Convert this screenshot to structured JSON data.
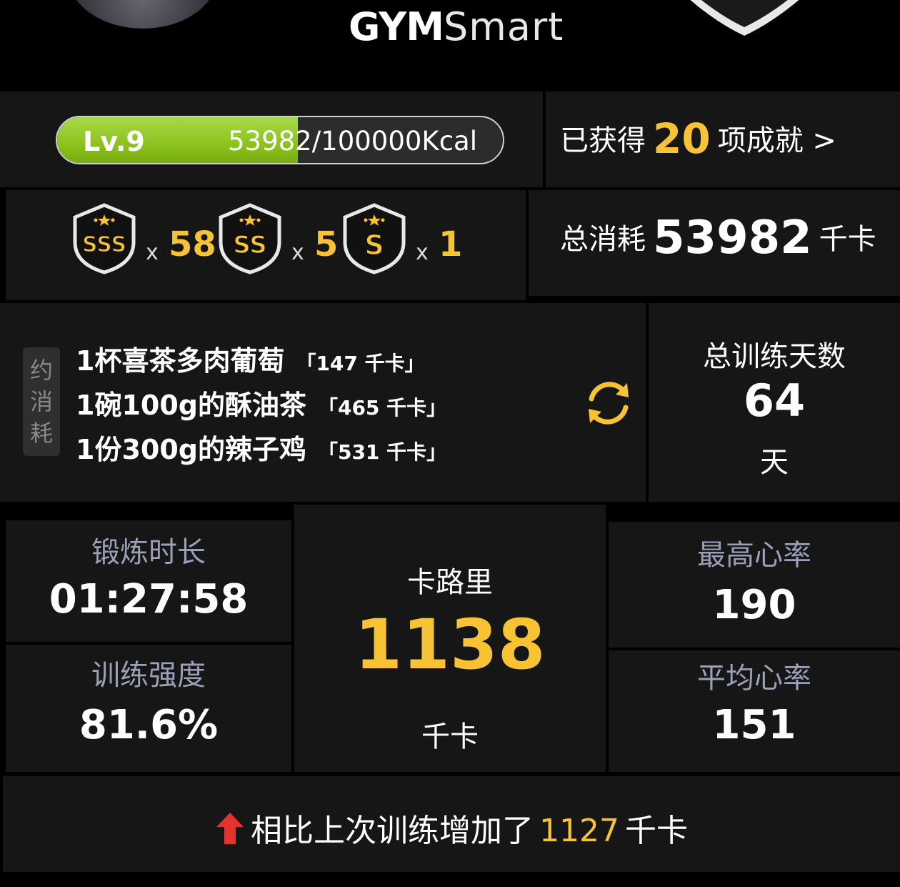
{
  "header": {
    "logo_bold": "GYM",
    "logo_light": "Smart"
  },
  "level": {
    "label": "Lv.9",
    "current_kcal": 53982,
    "target_kcal": 100000,
    "progress_text": "53982/100000Kcal",
    "progress_fraction": 0.54
  },
  "achievements": {
    "prefix": "已获得",
    "count": "20",
    "suffix": "项成就 >"
  },
  "grades": [
    {
      "grade": "SSS",
      "x": "x",
      "count": "58"
    },
    {
      "grade": "SS",
      "x": "x",
      "count": "5"
    },
    {
      "grade": "S",
      "x": "x",
      "count": "1"
    }
  ],
  "total_consumption": {
    "label": "总消耗",
    "value": "53982",
    "unit": "千卡"
  },
  "equivalent": {
    "tag": "约消耗",
    "items": [
      {
        "food": "1杯喜茶多肉葡萄",
        "kcal": "「147 千卡」"
      },
      {
        "food": "1碗100g的酥油茶",
        "kcal": "「465 千卡」"
      },
      {
        "food": "1份300g的辣子鸡",
        "kcal": "「531 千卡」"
      }
    ]
  },
  "training_days": {
    "label": "总训练天数",
    "value": "64",
    "unit": "天"
  },
  "stats": {
    "duration_label": "锻炼时长",
    "duration_value": "01:27:58",
    "intensity_label": "训练强度",
    "intensity_value": "81.6%",
    "calories_label": "卡路里",
    "calories_value": "1138",
    "calories_unit": "千卡",
    "max_hr_label": "最高心率",
    "max_hr_value": "190",
    "avg_hr_label": "平均心率",
    "avg_hr_value": "151"
  },
  "comparison": {
    "prefix": "相比上次训练增加了",
    "value": "1127",
    "unit": "千卡"
  },
  "colors": {
    "accent_gold": "#f7c233",
    "progress_green": "#8cc21d",
    "panel": "#161616",
    "label_grey": "#9aa0b8",
    "arrow_red": "#e5322d"
  }
}
